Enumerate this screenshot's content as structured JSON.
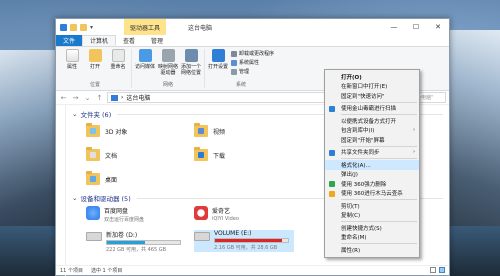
{
  "window": {
    "context_tab": "驱动器工具",
    "title": "这台电脑",
    "controls": {
      "minimize": "—",
      "maximize": "☐",
      "close": "✕"
    }
  },
  "ribbon_tabs": [
    "文件",
    "计算机",
    "查看",
    "管理"
  ],
  "ribbon": {
    "location_group": "位置",
    "network_group": "网络",
    "system_group": "系统",
    "buttons": {
      "properties": "属性",
      "open": "打开",
      "rename": "重命名",
      "access_media": "访问媒体",
      "map_drive": "映射网络驱动器",
      "add_location": "添加一个网络位置",
      "open_settings": "打开设置",
      "uninstall": "卸载或更改程序",
      "system_props": "系统属性",
      "manage": "管理"
    }
  },
  "address": {
    "path_root": "这台电脑",
    "search_placeholder": "搜索\"这台电脑\""
  },
  "sections": {
    "folders_header": "文件夹 (6)",
    "devices_header": "设备和驱动器 (5)"
  },
  "folders": [
    {
      "label": "3D 对象",
      "overlay": "#7cc3ea"
    },
    {
      "label": "视频",
      "overlay": "#5b8bd6"
    },
    {
      "label": "文档",
      "overlay": "#e0e0e0"
    },
    {
      "label": "下载",
      "overlay": "#2a7ad8"
    },
    {
      "label": "桌面",
      "overlay": "#60a7e8"
    }
  ],
  "devices": [
    {
      "title": "百度网盘",
      "sub": "双击运行百度网盘",
      "icon_color": "#3e88f0"
    },
    {
      "title": "爱奇艺",
      "sub": "iQIYI Video",
      "icon_color": "#e03a3a"
    }
  ],
  "drives": [
    {
      "title": "新加卷 (D:)",
      "sub": "222 GB 可用，共 465 GB",
      "fill": 0.52,
      "red": false
    },
    {
      "title": "VOLUME (E:)",
      "sub": "2.16 GB 可用，共 28.6 GB",
      "fill": 0.92,
      "red": true
    }
  ],
  "hidden_drive_text": "GB",
  "status": {
    "items": "11 个项目",
    "selected": "选中 1 个项目"
  },
  "context_menu": [
    {
      "label": "打开(O)",
      "bold": true
    },
    {
      "label": "在新窗口中打开(E)"
    },
    {
      "label": "固定到\"快速访问\""
    },
    {
      "sep": true
    },
    {
      "label": "使用金山毒霸进行扫描",
      "icon": "#2a82d6"
    },
    {
      "sep": true
    },
    {
      "label": "以便携式设备方式打开"
    },
    {
      "label": "包含到库中(I)",
      "arrow": true
    },
    {
      "label": "固定到\"开始\"屏幕"
    },
    {
      "sep": true
    },
    {
      "label": "共享文件夹同步",
      "icon": "#2f7fd6",
      "arrow": true
    },
    {
      "sep": true
    },
    {
      "label": "格式化(A)...",
      "hl": true
    },
    {
      "label": "弹出(J)"
    },
    {
      "label": "使用 360强力删除",
      "icon": "#2ea84a"
    },
    {
      "label": "使用 360进行木马云查杀",
      "icon": "#f0a820"
    },
    {
      "sep": true
    },
    {
      "label": "剪切(T)"
    },
    {
      "label": "复制(C)"
    },
    {
      "sep": true
    },
    {
      "label": "创建快捷方式(S)"
    },
    {
      "label": "重命名(M)"
    },
    {
      "sep": true
    },
    {
      "label": "属性(R)"
    }
  ]
}
